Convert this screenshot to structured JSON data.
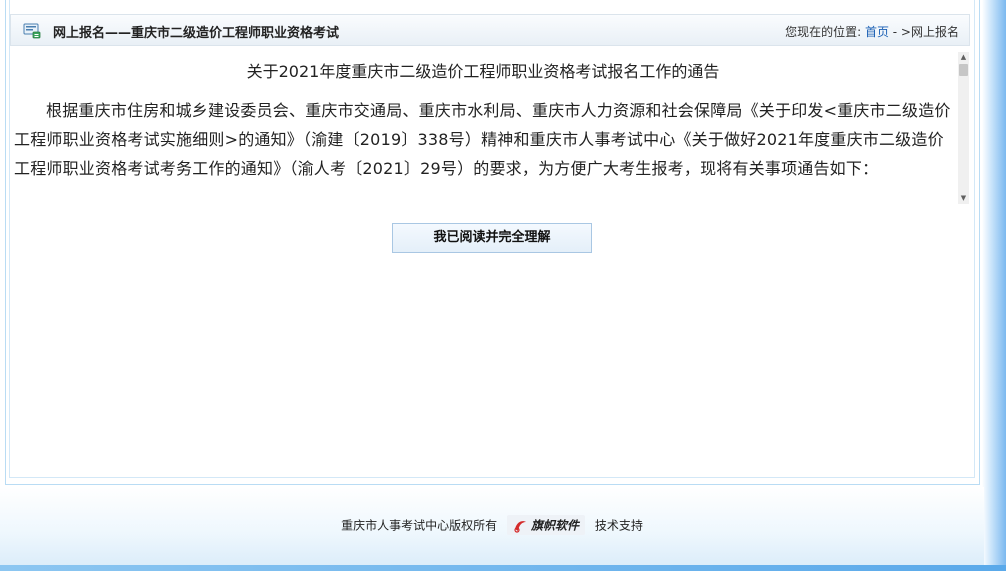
{
  "header": {
    "title": "网上报名——重庆市二级造价工程师职业资格考试",
    "location_label": "您现在的位置:",
    "home_link": "首页",
    "separator": " - >",
    "current": "网上报名"
  },
  "notice": {
    "title": "关于2021年度重庆市二级造价工程师职业资格考试报名工作的通告",
    "body": "根据重庆市住房和城乡建设委员会、重庆市交通局、重庆市水利局、重庆市人力资源和社会保障局《关于印发<重庆市二级造价工程师职业资格考试实施细则>的通知》（渝建〔2019〕338号）精神和重庆市人事考试中心《关于做好2021年度重庆市二级造价工程师职业资格考试考务工作的通知》（渝人考〔2021〕29号）的要求，为方便广大考生报考，现将有关事项通告如下："
  },
  "confirm_button": "我已阅读并完全理解",
  "footer": {
    "copyright": "重庆市人事考试中心版权所有",
    "logo_text": "旗帜软件",
    "support": "技术支持"
  },
  "colors": {
    "accent_link": "#1a5fb4",
    "border_blue": "#b9dcf4",
    "edge_gradient": "#7bb8ef"
  },
  "icons": {
    "header": "monitor-list-icon",
    "logo": "red-swoosh-icon"
  }
}
